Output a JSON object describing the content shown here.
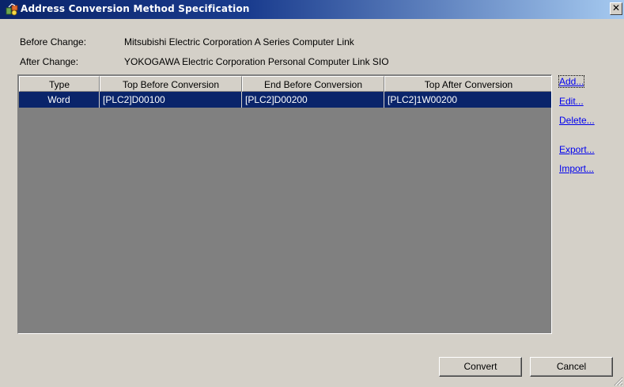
{
  "window": {
    "title": "Address Conversion Method Specification",
    "close_symbol": "✕"
  },
  "before_change": {
    "label": "Before Change:",
    "value": "Mitsubishi Electric Corporation A Series Computer Link"
  },
  "after_change": {
    "label": "After Change:",
    "value": "YOKOGAWA Electric Corporation Personal Computer Link SIO"
  },
  "table": {
    "columns": [
      "Type",
      "Top Before Conversion",
      "End Before Conversion",
      "Top After Conversion"
    ],
    "rows": [
      [
        "Word",
        "[PLC2]D00100",
        "[PLC2]D00200",
        "[PLC2]1W00200"
      ]
    ]
  },
  "actions": {
    "add": "Add...",
    "edit": "Edit...",
    "delete": "Delete...",
    "export": "Export...",
    "import": "Import..."
  },
  "buttons": {
    "convert": "Convert",
    "cancel": "Cancel"
  },
  "colors": {
    "title_start": "#0a246a",
    "title_end": "#a6caf0",
    "selection": "#0a246a",
    "link": "#0000ee",
    "face": "#d4d0c8"
  }
}
